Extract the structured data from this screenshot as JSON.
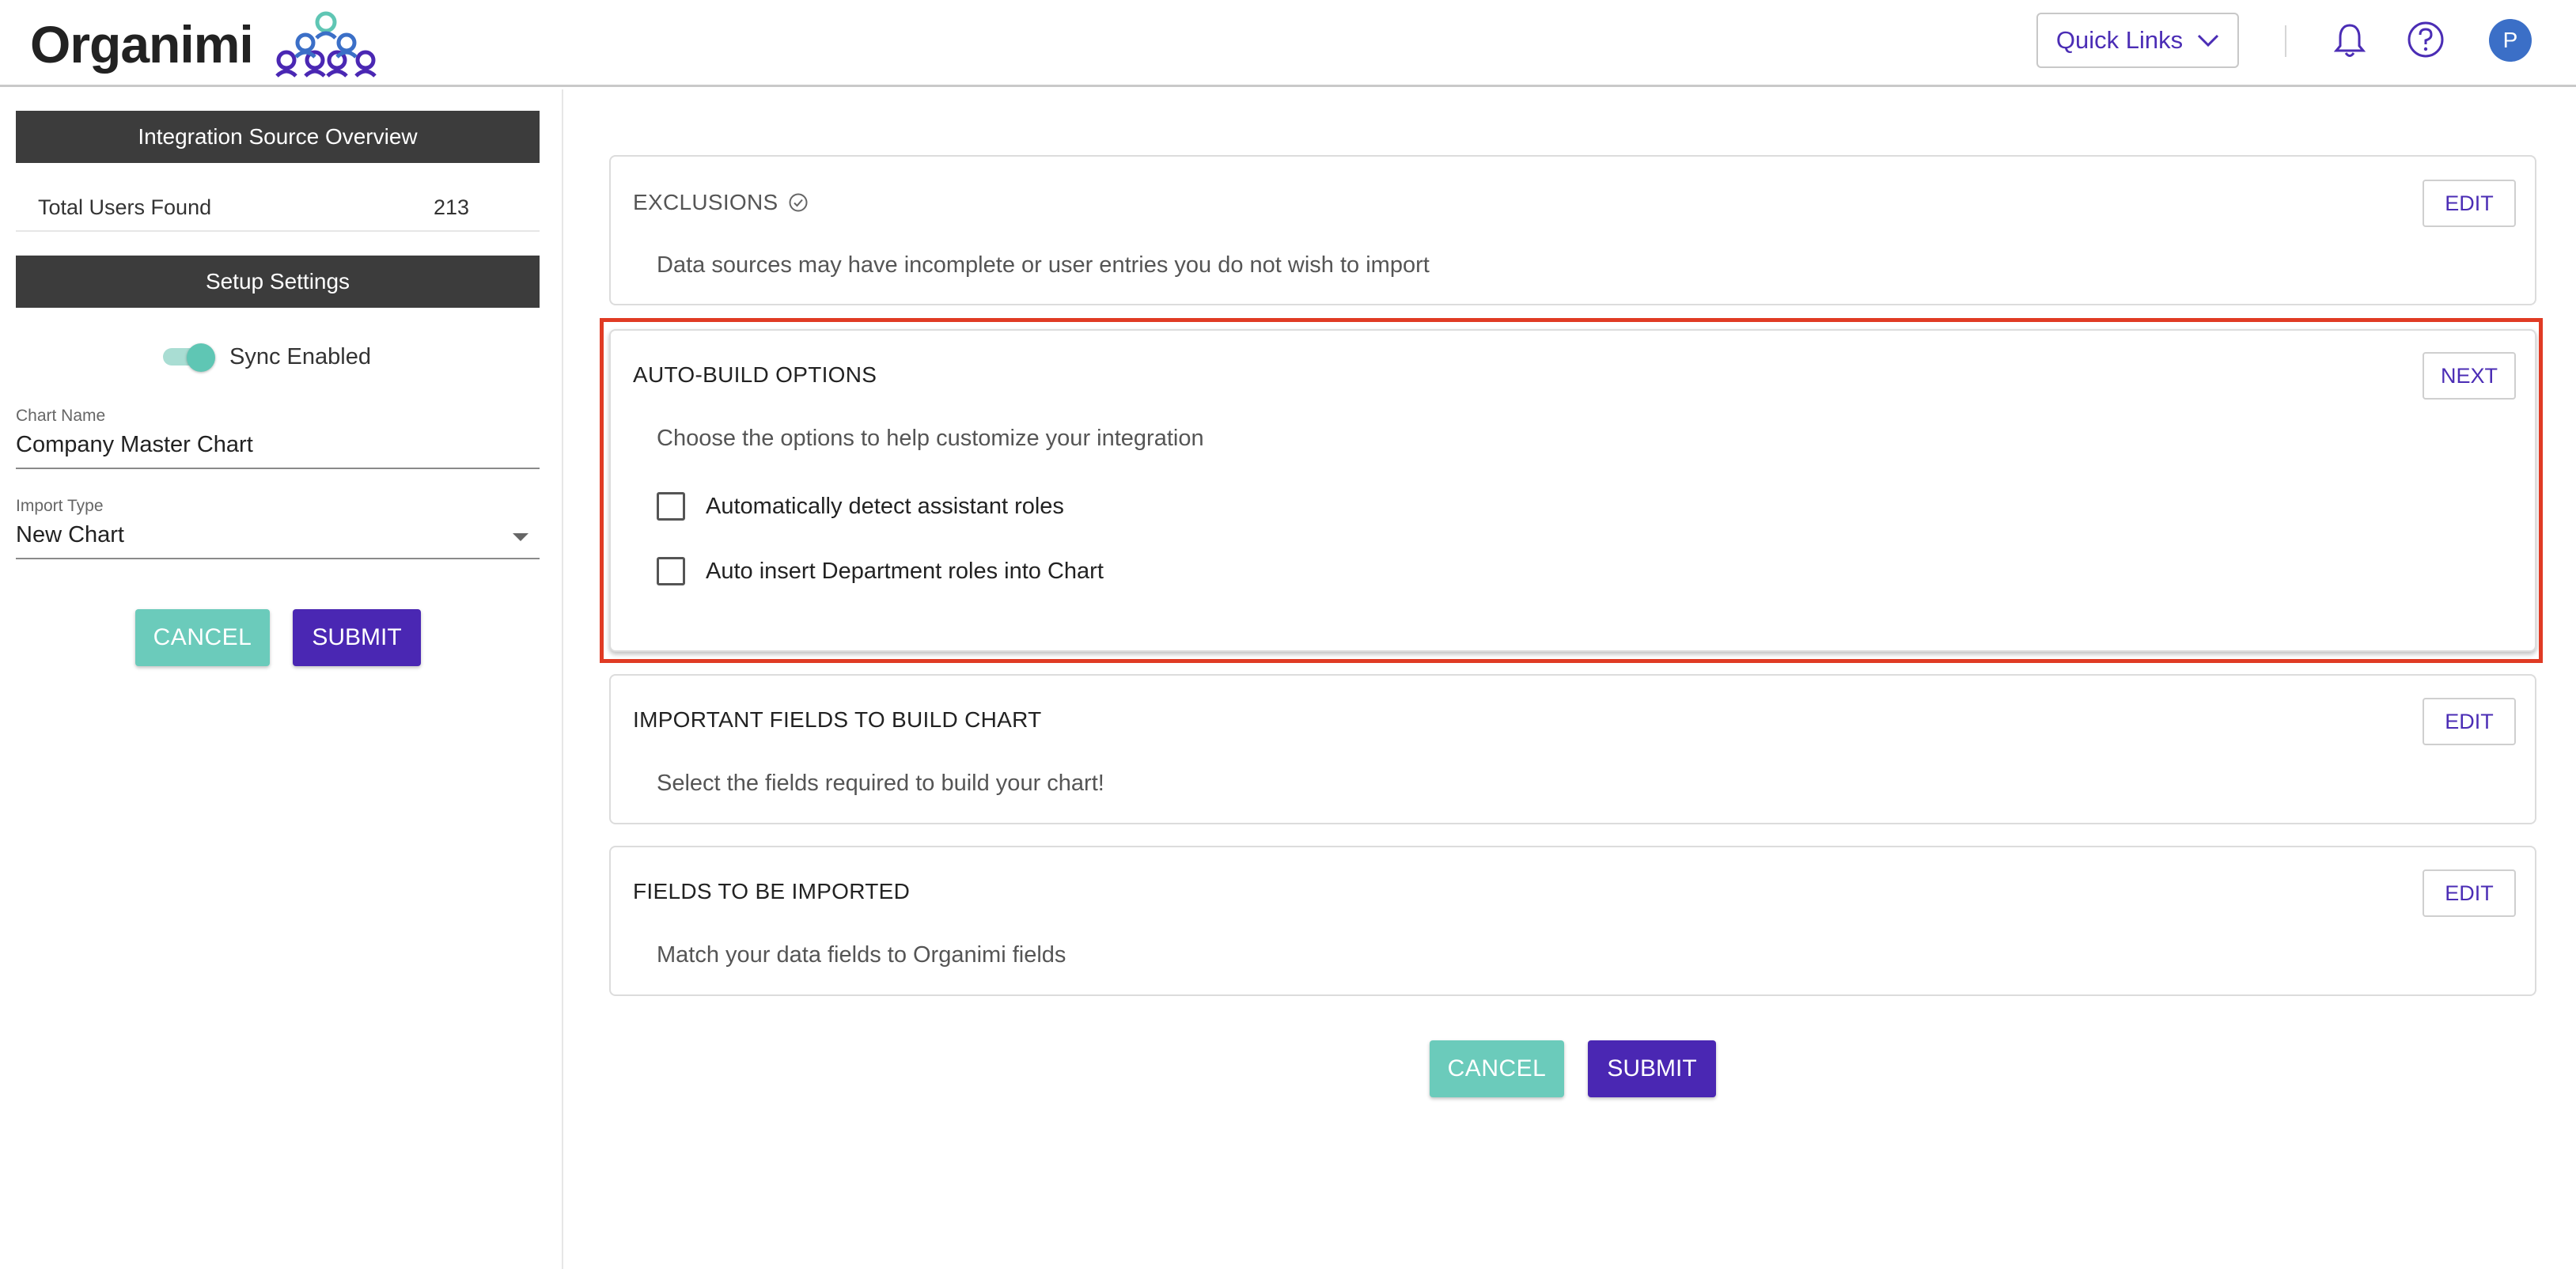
{
  "header": {
    "logo_text": "Organimi",
    "quick_links_label": "Quick Links",
    "avatar_initial": "P"
  },
  "sidebar": {
    "overview_title": "Integration Source Overview",
    "total_users_label": "Total Users Found",
    "total_users_value": "213",
    "setup_title": "Setup Settings",
    "sync_label": "Sync Enabled",
    "sync_enabled": true,
    "chart_name_label": "Chart Name",
    "chart_name_value": "Company Master Chart",
    "import_type_label": "Import Type",
    "import_type_value": "New Chart",
    "cancel_label": "CANCEL",
    "submit_label": "SUBMIT"
  },
  "main": {
    "exclusions": {
      "title": "EXCLUSIONS",
      "description": "Data sources may have incomplete or user entries you do not wish to import",
      "button_label": "EDIT"
    },
    "auto_build": {
      "title": "AUTO-BUILD OPTIONS",
      "description": "Choose the options to help customize your integration",
      "button_label": "NEXT",
      "options": [
        {
          "label": "Automatically detect assistant roles",
          "checked": false
        },
        {
          "label": "Auto insert Department roles into Chart",
          "checked": false
        }
      ]
    },
    "important_fields": {
      "title": "IMPORTANT FIELDS TO BUILD CHART",
      "description": "Select the fields required to build your chart!",
      "button_label": "EDIT"
    },
    "fields_imported": {
      "title": "FIELDS TO BE IMPORTED",
      "description": "Match your data fields to Organimi fields",
      "button_label": "EDIT"
    },
    "cancel_label": "CANCEL",
    "submit_label": "SUBMIT"
  },
  "colors": {
    "brand_purple": "#4a27b3",
    "teal": "#6bcbbb",
    "highlight_red": "#e03b24"
  },
  "icons": [
    "organimi-logo-icon",
    "chevron-down-icon",
    "bell-icon",
    "help-icon",
    "check-circle-icon"
  ]
}
